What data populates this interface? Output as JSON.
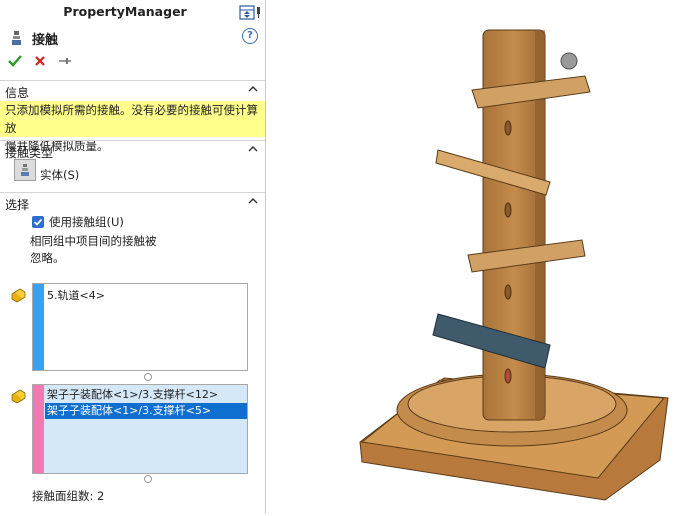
{
  "panel": {
    "title": "PropertyManager",
    "feature_name": "接触",
    "help_symbol": "?"
  },
  "sections": {
    "info": {
      "header": "信息",
      "text_line1": "只添加模拟所需的接触。没有必要的接触可使计算放",
      "text_line2": "慢并降低模拟质量。"
    },
    "contact_type": {
      "header": "接触类型",
      "solid_label": "实体(S)"
    },
    "selection": {
      "header": "选择",
      "use_groups_label": "使用接触组(U)",
      "use_groups_checked": true,
      "note_line1": "相同组中项目间的接触被",
      "note_line2": "忽略。",
      "group1_items": [
        "5.轨道<4>"
      ],
      "group2_items": [
        "架子子装配体<1>/3.支撑杆<12>",
        "架子子装配体<1>/3.支撑杆<5>"
      ],
      "count_label": "接触面组数: 2"
    }
  },
  "colors": {
    "info_bg": "#ffff8c",
    "group1_bar": "#3aa0f0",
    "group2_bar": "#f07ab4",
    "selection_highlight": "#0f6fd0",
    "list2_bg": "#d5e8f8",
    "ok": "#2a9a2a",
    "cancel": "#d42020"
  }
}
